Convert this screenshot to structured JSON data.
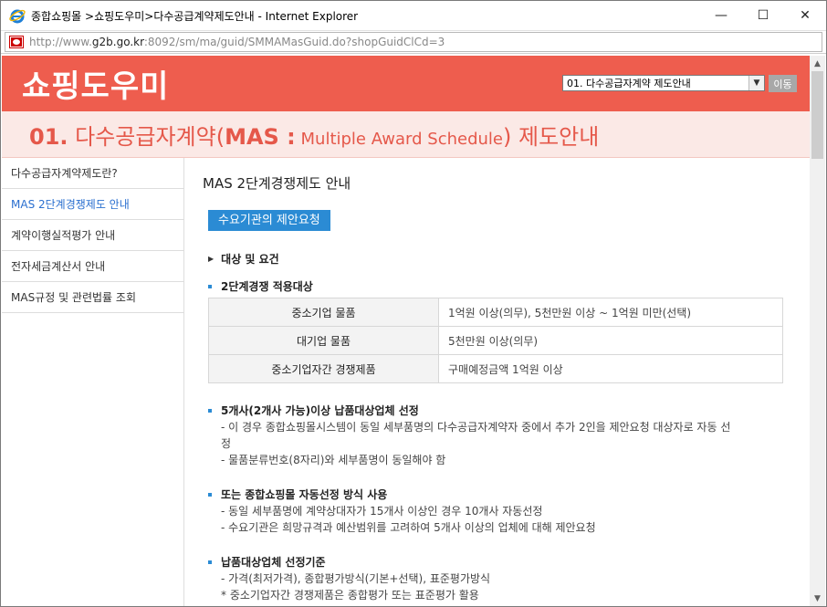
{
  "window": {
    "title": "종합쇼핑몰 >쇼핑도우미>다수공급계약제도안내 - Internet Explorer",
    "url_prefix": "http://www.",
    "url_domain": "g2b.go.kr",
    "url_suffix": ":8092/sm/ma/guid/SMMAMasGuid.do?shopGuidClCd=3",
    "minimize": "—",
    "maximize": "☐",
    "close": "✕"
  },
  "header": {
    "title": "쇼핑도우미",
    "select_value": "01. 다수공급자계약 제도안내",
    "go_label": "이동"
  },
  "subheader": {
    "num": "01.",
    "text1": " 다수공급자계약(",
    "mas": "MAS :",
    "eng": " Multiple Award Schedule",
    "text2": ") 제도안내"
  },
  "sidebar": {
    "items": [
      {
        "label": "다수공급자계약제도란?"
      },
      {
        "label": "MAS 2단계경쟁제도 안내"
      },
      {
        "label": "계약이행실적평가 안내"
      },
      {
        "label": "전자세금계산서 안내"
      },
      {
        "label": "MAS규정 및 관련법률 조회"
      }
    ]
  },
  "article": {
    "title": "MAS 2단계경쟁제도 안내",
    "chip": "수요기관의 제안요청",
    "section1": "대상 및 요건",
    "subsection1": "2단계경쟁 적용대상",
    "table": [
      {
        "k": "중소기업 물품",
        "v": "1억원 이상(의무), 5천만원 이상 ~ 1억원 미만(선택)"
      },
      {
        "k": "대기업 물품",
        "v": "5천만원 이상(의무)"
      },
      {
        "k": "중소기업자간 경쟁제품",
        "v": "구매예정금액 1억원 이상"
      }
    ],
    "block1": {
      "heading": "5개사(2개사 가능)이상 납품대상업체 선정",
      "l1": "- 이 경우 종합쇼핑몰시스템이 동일 세부품명의 다수공급자계약자 중에서 추가 2인을 제안요청 대상자로 자동 선",
      "l1b": "정",
      "l2": "- 물품분류번호(8자리)와 세부품명이 동일해야 함"
    },
    "block2": {
      "heading": "또는 종합쇼핑몰 자동선정 방식 사용",
      "l1": "- 동일 세부품명에 계약상대자가 15개사 이상인 경우 10개사 자동선정",
      "l2": "- 수요기관은 희망규격과 예산범위를 고려하여 5개사 이상의 업체에 대해 제안요청"
    },
    "block3": {
      "heading": "납품대상업체 선정기준",
      "l1": "- 가격(최저가격), 종합평가방식(기본+선택), 표준평가방식",
      "l2": "* 중소기업자간 경쟁제품은 종합평가 또는 표준평가 활용"
    }
  },
  "colors": {
    "header_bg": "#ee5d4e",
    "subheader_bg": "#fbe9e6",
    "accent_blue": "#2b8bd4"
  }
}
